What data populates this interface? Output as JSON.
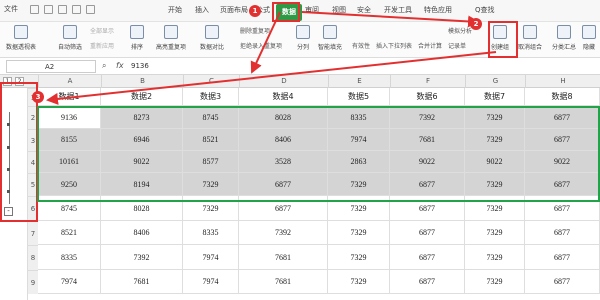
{
  "menu": {
    "file": "文件",
    "tabs": [
      "开始",
      "插入",
      "页面布局",
      "公式",
      "数据",
      "审阅",
      "视图",
      "安全",
      "开发工具",
      "特色应用"
    ],
    "active_tab": "数据",
    "search": "Q查找"
  },
  "ribbon": {
    "pivot": "数据透视表",
    "autofilter": "自动筛选",
    "show_all": "全部显示",
    "reapply": "重新应用",
    "sort": "排序",
    "highlight_dup": "高亮重复项",
    "data_compare": "数据对比",
    "delete_dup": "删除重复项",
    "reject_dup": "拒绝录入重复项",
    "split": "分列",
    "fill": "智能填充",
    "validity": "有效性",
    "dropdown": "插入下拉列表",
    "consolidate": "合并计算",
    "record": "记录单",
    "simulate": "模拟分析",
    "create_group": "创建组",
    "ungroup": "取消组合",
    "subtotal": "分类汇总",
    "hide_detail": "隐藏"
  },
  "formula_bar": {
    "cell_ref": "A2",
    "value": "9136"
  },
  "outline_levels": [
    "1",
    "2"
  ],
  "columns": [
    "A",
    "B",
    "C",
    "D",
    "E",
    "F",
    "G",
    "H"
  ],
  "row_numbers": [
    "1",
    "2",
    "3",
    "4",
    "5",
    "6",
    "7",
    "8",
    "9"
  ],
  "header_row": [
    "数据1",
    "数据2",
    "数据3",
    "数据4",
    "数据5",
    "数据6",
    "数据7",
    "数据8"
  ],
  "rows": [
    [
      "9136",
      "8273",
      "8745",
      "8028",
      "8335",
      "7392",
      "7329",
      "6877"
    ],
    [
      "8155",
      "6946",
      "8521",
      "8406",
      "7974",
      "7681",
      "7329",
      "6877"
    ],
    [
      "10161",
      "9022",
      "8577",
      "3528",
      "2863",
      "9022",
      "9022",
      "9022"
    ],
    [
      "9250",
      "8194",
      "7329",
      "6877",
      "7329",
      "6877",
      "7329",
      "6877"
    ],
    [
      "8745",
      "8028",
      "7329",
      "6877",
      "7329",
      "6877",
      "7329",
      "6877"
    ],
    [
      "8521",
      "8406",
      "8335",
      "7392",
      "7329",
      "6877",
      "7329",
      "6877"
    ],
    [
      "8335",
      "7392",
      "7974",
      "7681",
      "7329",
      "6877",
      "7329",
      "6877"
    ],
    [
      "7974",
      "7681",
      "7974",
      "7681",
      "7329",
      "6877",
      "7329",
      "6877"
    ]
  ],
  "annotations": [
    "1",
    "2",
    "3"
  ],
  "colors": {
    "active_tab": "#2e9a45",
    "annotation_red": "#e23030",
    "selection_border": "#22a34a",
    "selection_fill": "#d4d4d4"
  }
}
